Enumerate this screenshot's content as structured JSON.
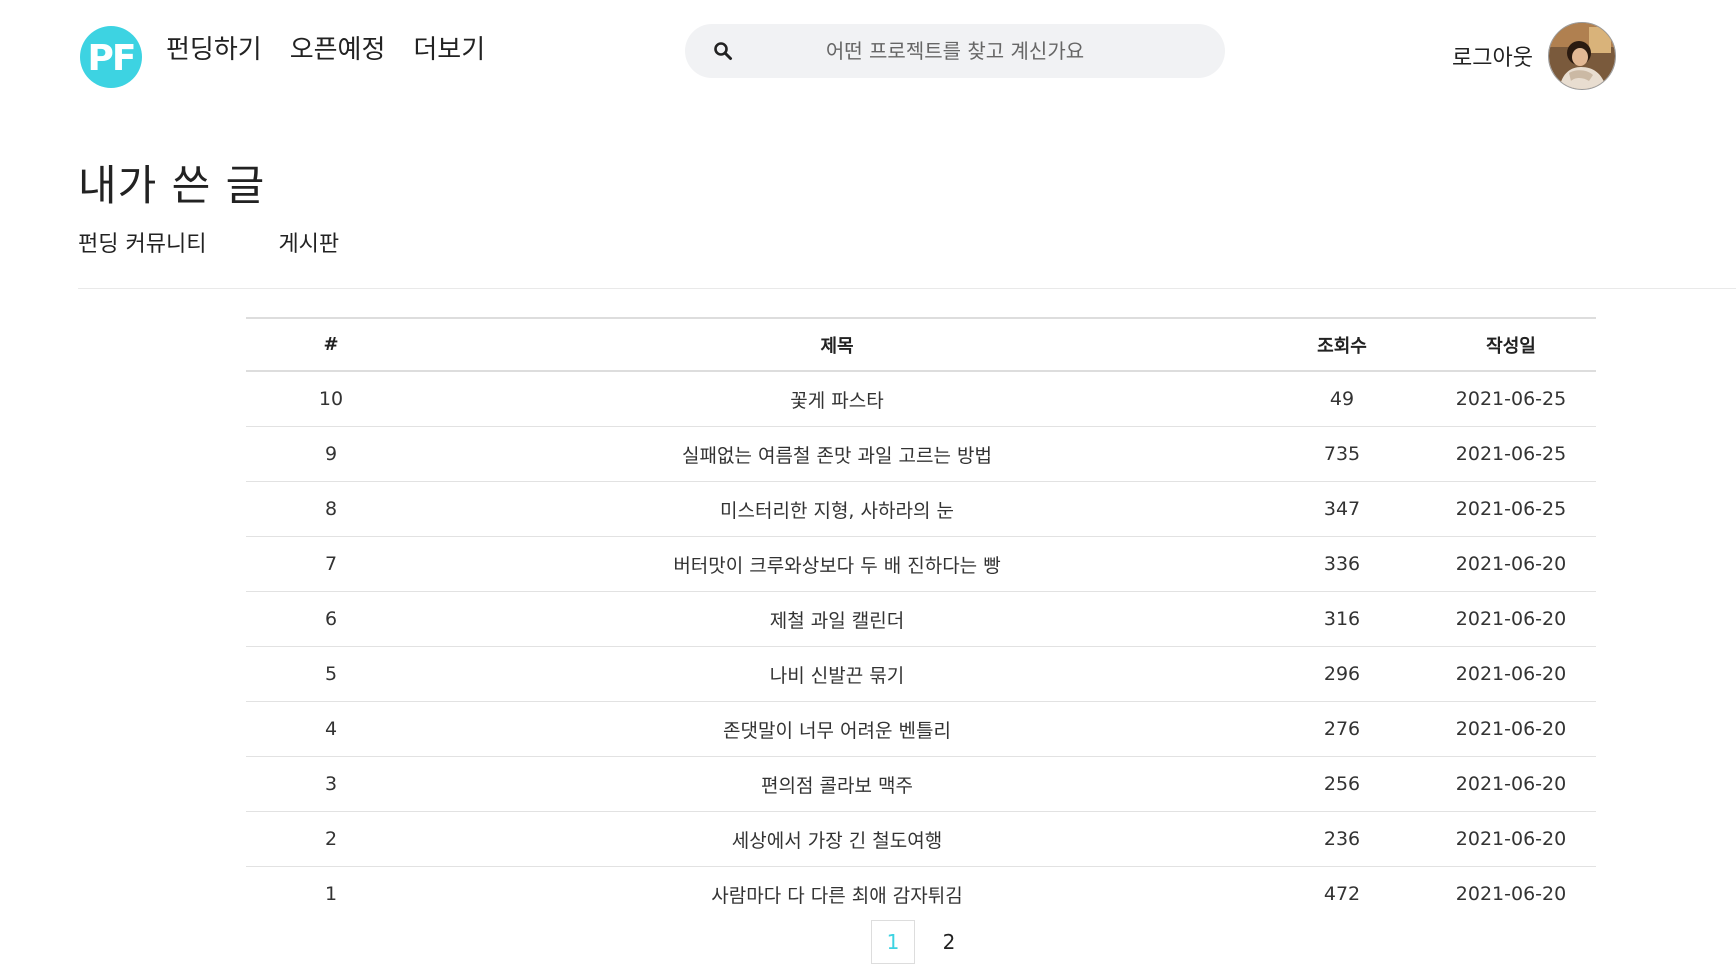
{
  "header": {
    "logo_text": "PF",
    "nav": [
      {
        "label": "펀딩하기"
      },
      {
        "label": "오픈예정"
      },
      {
        "label": "더보기"
      }
    ],
    "search": {
      "placeholder": "어떤 프로젝트를 찾고 계신가요",
      "icon": "search-icon"
    },
    "logout_label": "로그아웃",
    "avatar_icon": "avatar"
  },
  "page_title": "내가 쓴 글",
  "tabs": [
    {
      "label": "펀딩 커뮤니티"
    },
    {
      "label": "게시판"
    }
  ],
  "table": {
    "columns": [
      "#",
      "제목",
      "조회수",
      "작성일"
    ],
    "rows": [
      {
        "no": "10",
        "title": "꽃게 파스타",
        "views": "49",
        "date": "2021-06-25"
      },
      {
        "no": "9",
        "title": "실패없는 여름철 존맛 과일 고르는 방법",
        "views": "735",
        "date": "2021-06-25"
      },
      {
        "no": "8",
        "title": "미스터리한 지형, 사하라의 눈",
        "views": "347",
        "date": "2021-06-25"
      },
      {
        "no": "7",
        "title": "버터맛이 크루와상보다 두 배 진하다는 빵",
        "views": "336",
        "date": "2021-06-20"
      },
      {
        "no": "6",
        "title": "제철 과일 캘린더",
        "views": "316",
        "date": "2021-06-20"
      },
      {
        "no": "5",
        "title": "나비 신발끈 묶기",
        "views": "296",
        "date": "2021-06-20"
      },
      {
        "no": "4",
        "title": "존댓말이 너무 어려운 벤틀리",
        "views": "276",
        "date": "2021-06-20"
      },
      {
        "no": "3",
        "title": "편의점 콜라보 맥주",
        "views": "256",
        "date": "2021-06-20"
      },
      {
        "no": "2",
        "title": "세상에서 가장 긴 철도여행",
        "views": "236",
        "date": "2021-06-20"
      },
      {
        "no": "1",
        "title": "사람마다 다 다른 최애 감자튀김",
        "views": "472",
        "date": "2021-06-20"
      }
    ]
  },
  "pagination": {
    "pages": [
      "1",
      "2"
    ],
    "current": "1"
  },
  "colors": {
    "accent": "#3dd3e2",
    "search_bg": "#f1f2f4",
    "border": "#dddddd"
  }
}
